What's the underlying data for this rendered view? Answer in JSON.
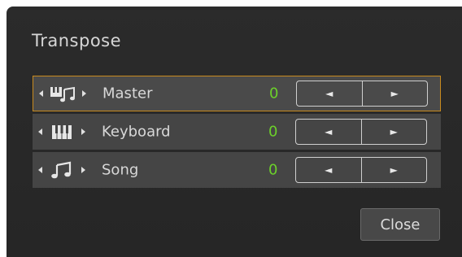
{
  "dialog": {
    "title": "Transpose",
    "rows": [
      {
        "label": "Master",
        "value": "0",
        "icon": "master-icon",
        "selected": true
      },
      {
        "label": "Keyboard",
        "value": "0",
        "icon": "keyboard-icon",
        "selected": false
      },
      {
        "label": "Song",
        "value": "0",
        "icon": "song-icon",
        "selected": false
      }
    ],
    "stepper": {
      "decrease": "◄",
      "increase": "►"
    },
    "close_label": "Close",
    "colors": {
      "accent": "#c88a1e",
      "value": "#6cd12a",
      "background": "#2b2b2b",
      "row": "#454545"
    }
  }
}
